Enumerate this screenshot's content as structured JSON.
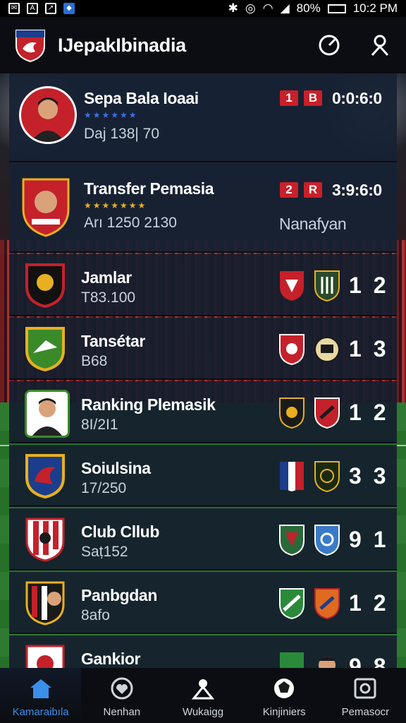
{
  "status_bar": {
    "battery": "80%",
    "time": "10:2 PM"
  },
  "app": {
    "title": "IJepakIbinadia"
  },
  "rows": [
    {
      "title": "Sepa Bala Ioaai",
      "subtitle": "Daj 138| 70",
      "badge1": "1",
      "badge2": "B",
      "time": "0:0:6:0",
      "star_color": "#3a6ee8"
    },
    {
      "title": "Transfer Pemasia",
      "subtitle": "Arı 1250 2130",
      "badge1": "2",
      "badge2": "R",
      "time": "3:9:6:0",
      "right_label": "Nanafyan",
      "star_color": "#e8b020"
    },
    {
      "title": "Jamlar",
      "subtitle": "T83.100",
      "score": "1 2"
    },
    {
      "title": "Tansétar",
      "subtitle": "B68",
      "score": "1 3"
    },
    {
      "title": "Ranking Plemasik",
      "subtitle": "8I/2I1",
      "score": "1 2"
    },
    {
      "title": "Soiulsina",
      "subtitle": "17/250",
      "score": "3 3"
    },
    {
      "title": "Club Cllub",
      "subtitle": "Saṭ152",
      "score": "9 1"
    },
    {
      "title": "Panbgdan",
      "subtitle": "8afo",
      "score": "1 2"
    },
    {
      "title": "Gankior",
      "subtitle": "",
      "score": "9 8"
    }
  ],
  "nav": [
    {
      "label": "Kamaraibıla",
      "icon": "home-icon",
      "active": true
    },
    {
      "label": "Nenhan",
      "icon": "heart-icon"
    },
    {
      "label": "Wukaigg",
      "icon": "person-icon"
    },
    {
      "label": "Kinjiniers",
      "icon": "ball-icon"
    },
    {
      "label": "Pemasocr",
      "icon": "camera-icon"
    }
  ],
  "colors": {
    "accent": "#3a8fe8",
    "badge_red": "#c9202a",
    "row_bg": "#141e2d"
  }
}
